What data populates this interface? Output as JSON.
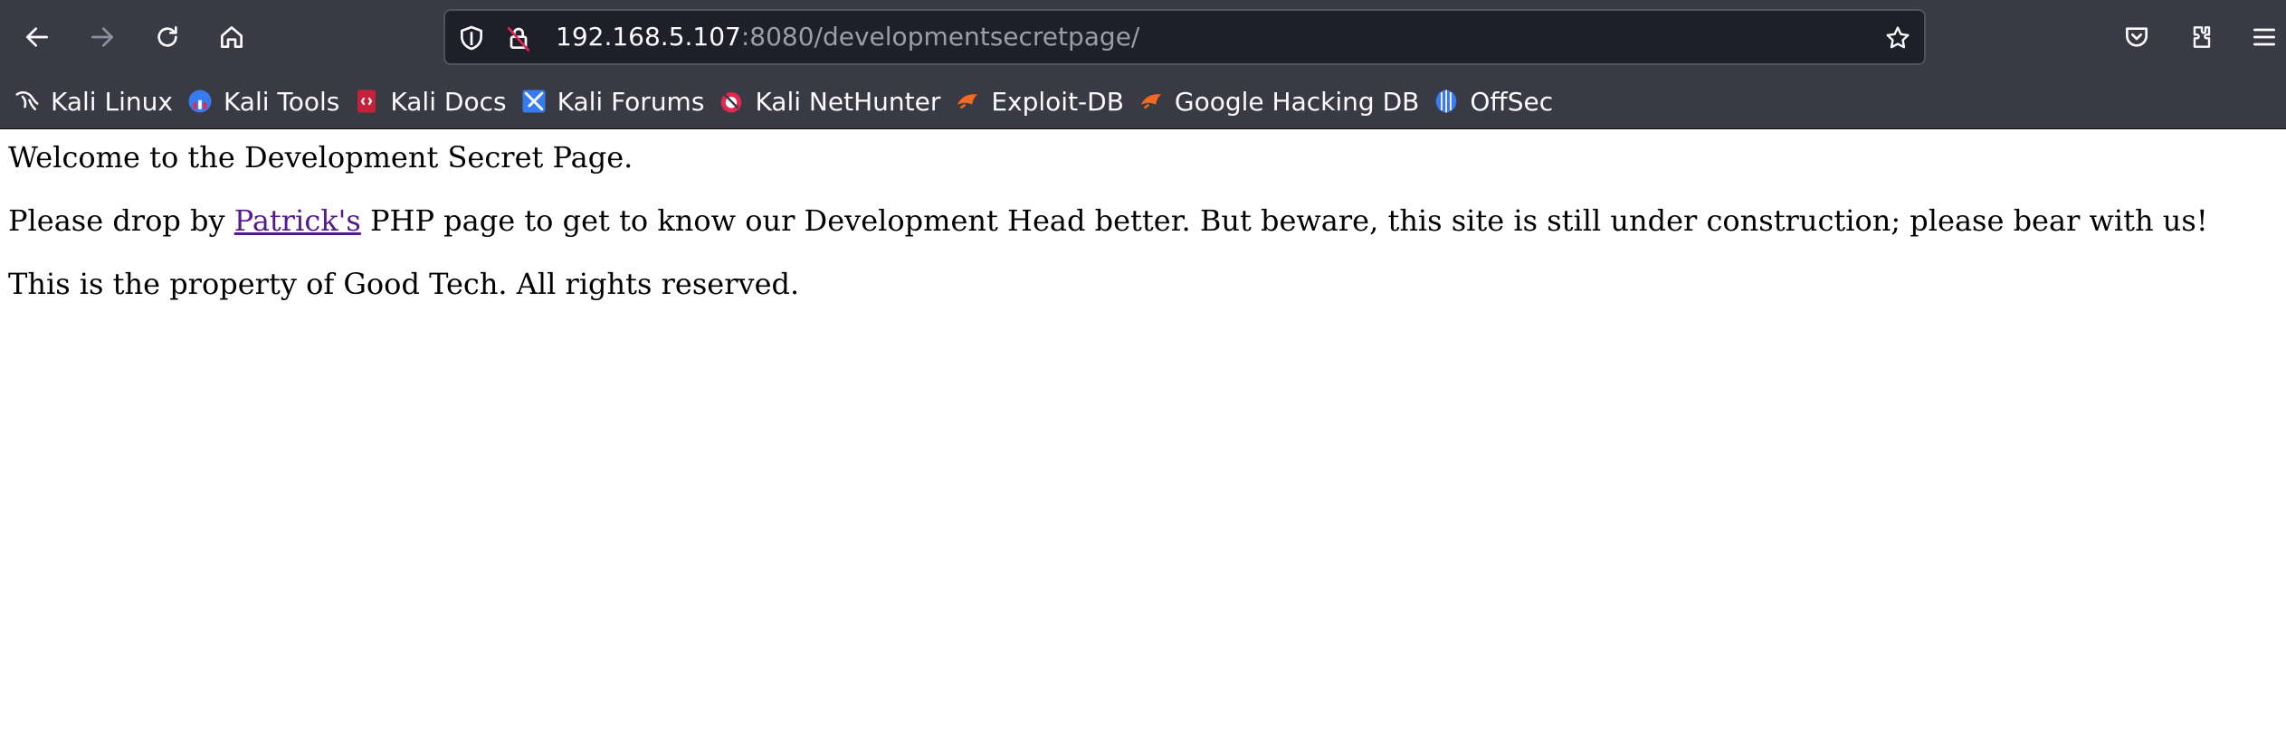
{
  "browser": {
    "toolbar": {
      "back_icon": "back-arrow-icon",
      "forward_icon": "forward-arrow-icon",
      "reload_icon": "reload-icon",
      "home_icon": "home-icon"
    },
    "urlbar": {
      "host": "192.168.5.107",
      "rest": ":8080/developmentsecretpage/",
      "shield_icon": "shield-icon",
      "insecure_lock_icon": "insecure-lock-icon",
      "bookmark_star_icon": "star-icon"
    },
    "right_icons": [
      "pocket-icon",
      "extensions-icon",
      "menu-icon"
    ],
    "bookmarks": [
      {
        "label": "Kali Linux",
        "icon": "kali-dragon-icon"
      },
      {
        "label": "Kali Tools",
        "icon": "kali-tools-icon"
      },
      {
        "label": "Kali Docs",
        "icon": "kali-docs-icon"
      },
      {
        "label": "Kali Forums",
        "icon": "kali-forums-icon"
      },
      {
        "label": "Kali NetHunter",
        "icon": "nethunter-icon"
      },
      {
        "label": "Exploit-DB",
        "icon": "exploit-db-icon"
      },
      {
        "label": "Google Hacking DB",
        "icon": "ghdb-icon"
      },
      {
        "label": "OffSec",
        "icon": "offsec-icon"
      }
    ]
  },
  "content": {
    "line1": "Welcome to the Development Secret Page.",
    "line2_before": "Please drop by ",
    "line2_link": "Patrick's",
    "line2_after": " PHP page to get to know our Development Head better. But beware, this site is still under construction; please bear with us!",
    "line3": "This is the property of Good Tech. All rights reserved."
  },
  "colors": {
    "chrome_bg": "#3a3a45",
    "urlbar_bg": "#1f1f2a",
    "link_visited": "#551a8b"
  }
}
